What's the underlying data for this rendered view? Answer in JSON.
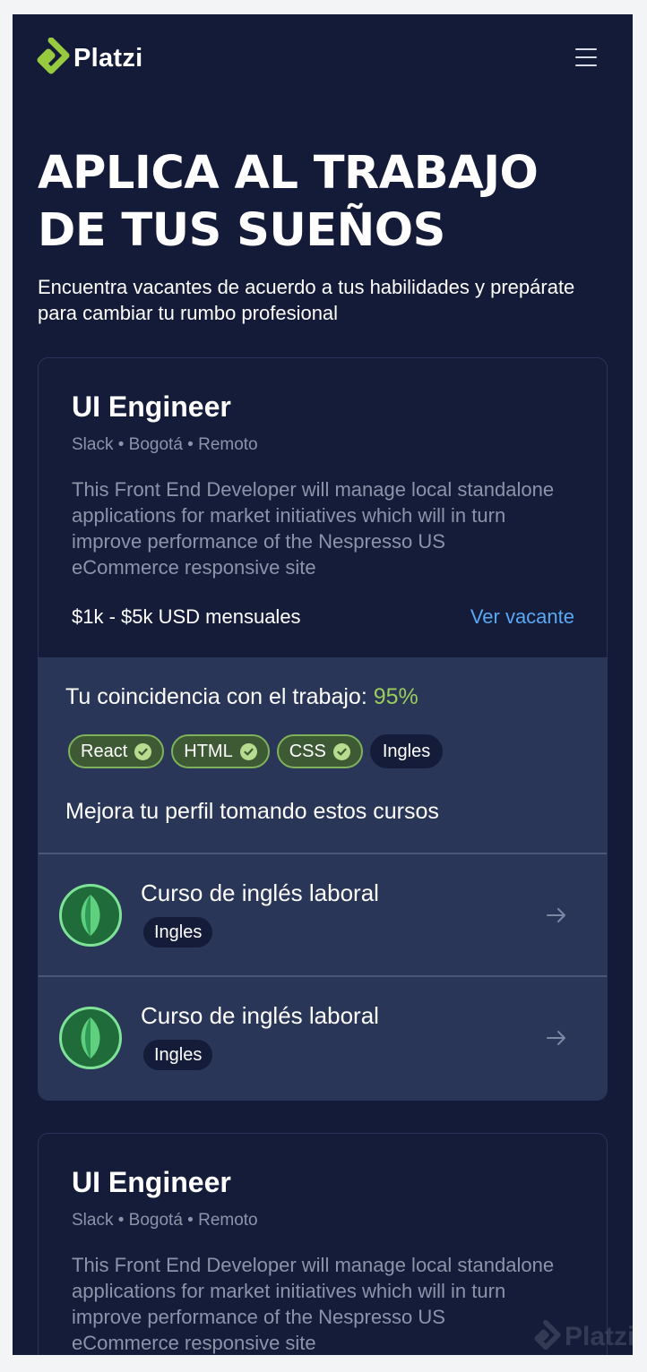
{
  "brand": {
    "name": "Platzi",
    "accent": "#98ca3f"
  },
  "header": {
    "menu_icon": "hamburger-icon"
  },
  "hero": {
    "title": "APLICA AL TRABAJO\nDE TUS SUEÑOS",
    "subtitle": "Encuentra vacantes de acuerdo a tus habilidades y prepárate para cambiar tu rumbo profesional"
  },
  "jobs": [
    {
      "title": "UI Engineer",
      "meta": "Slack • Bogotá • Remoto",
      "description": "This Front End Developer will manage local standalone applications for market initiatives which will in turn improve performance of the Nespresso US eCommerce responsive site",
      "salary": "$1k - $5k USD mensuales",
      "link_label": "Ver vacante",
      "match_label": "Tu coincidencia con el trabajo: ",
      "match_value": "95%",
      "skills": [
        {
          "label": "React",
          "matched": true
        },
        {
          "label": "HTML",
          "matched": true
        },
        {
          "label": "CSS",
          "matched": true
        },
        {
          "label": "Ingles",
          "matched": false
        }
      ],
      "improve_label": "Mejora tu perfil tomando estos cursos",
      "courses": [
        {
          "title": "Curso de inglés laboral",
          "tag": "Ingles",
          "icon": "leaf-icon"
        },
        {
          "title": "Curso de inglés laboral",
          "tag": "Ingles",
          "icon": "leaf-icon"
        }
      ]
    },
    {
      "title": "UI Engineer",
      "meta": "Slack • Bogotá • Remoto",
      "description": "This Front End Developer will manage local standalone applications for market initiatives which will in turn improve performance of the Nespresso US eCommerce responsive site"
    }
  ],
  "watermark": "Platzi"
}
